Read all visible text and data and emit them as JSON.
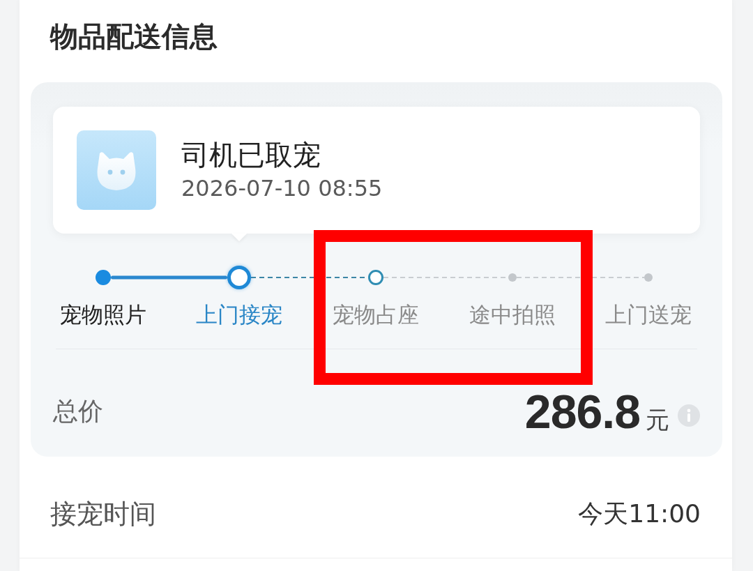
{
  "section": {
    "title": "物品配送信息"
  },
  "status_card": {
    "title": "司机已取宠",
    "time": "2026-07-10 08:55"
  },
  "steps": [
    {
      "label": "宠物照片",
      "kind": "done",
      "highlighted": false
    },
    {
      "label": "上门接宠",
      "kind": "current",
      "highlighted": false
    },
    {
      "label": "宠物占座",
      "kind": "next",
      "highlighted": true
    },
    {
      "label": "途中拍照",
      "kind": "pending",
      "highlighted": true
    },
    {
      "label": "上门送宠",
      "kind": "pending",
      "highlighted": false
    }
  ],
  "total": {
    "label": "总价",
    "amount": "286.8",
    "unit": "元"
  },
  "pickup_time": {
    "label": "接宠时间",
    "value": "今天11:00"
  }
}
